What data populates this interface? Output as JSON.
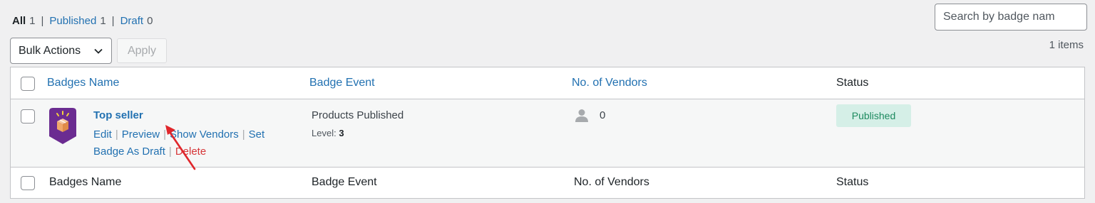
{
  "filters": {
    "all": {
      "label": "All",
      "count": "1"
    },
    "published": {
      "label": "Published",
      "count": "1"
    },
    "draft": {
      "label": "Draft",
      "count": "0"
    },
    "separator": "|"
  },
  "search": {
    "placeholder": "Search by badge nam"
  },
  "bulk_actions": {
    "label": "Bulk Actions",
    "apply_label": "Apply"
  },
  "items_count": "1 items",
  "table": {
    "columns": [
      "Badges Name",
      "Badge Event",
      "No. of Vendors",
      "Status"
    ],
    "rows": [
      {
        "title": "Top seller",
        "actions": {
          "edit": "Edit",
          "preview": "Preview",
          "show_vendors": "Show Vendors",
          "set_draft": "Set Badge As Draft",
          "delete": "Delete",
          "separator": "|"
        },
        "event": "Products Published",
        "level_label": "Level:",
        "level_value": "3",
        "vendors": "0",
        "status": "Published"
      }
    ]
  },
  "icons": {
    "badge": "gift-box-badge-icon",
    "vendor": "person-icon",
    "chevron": "chevron-down-icon"
  },
  "colors": {
    "link": "#2271b1",
    "delete": "#d63638",
    "badge_purple": "#6b2c91",
    "status_bg": "#d5efe7",
    "status_text": "#1d8a5f",
    "annotation_arrow": "#e0262b"
  }
}
